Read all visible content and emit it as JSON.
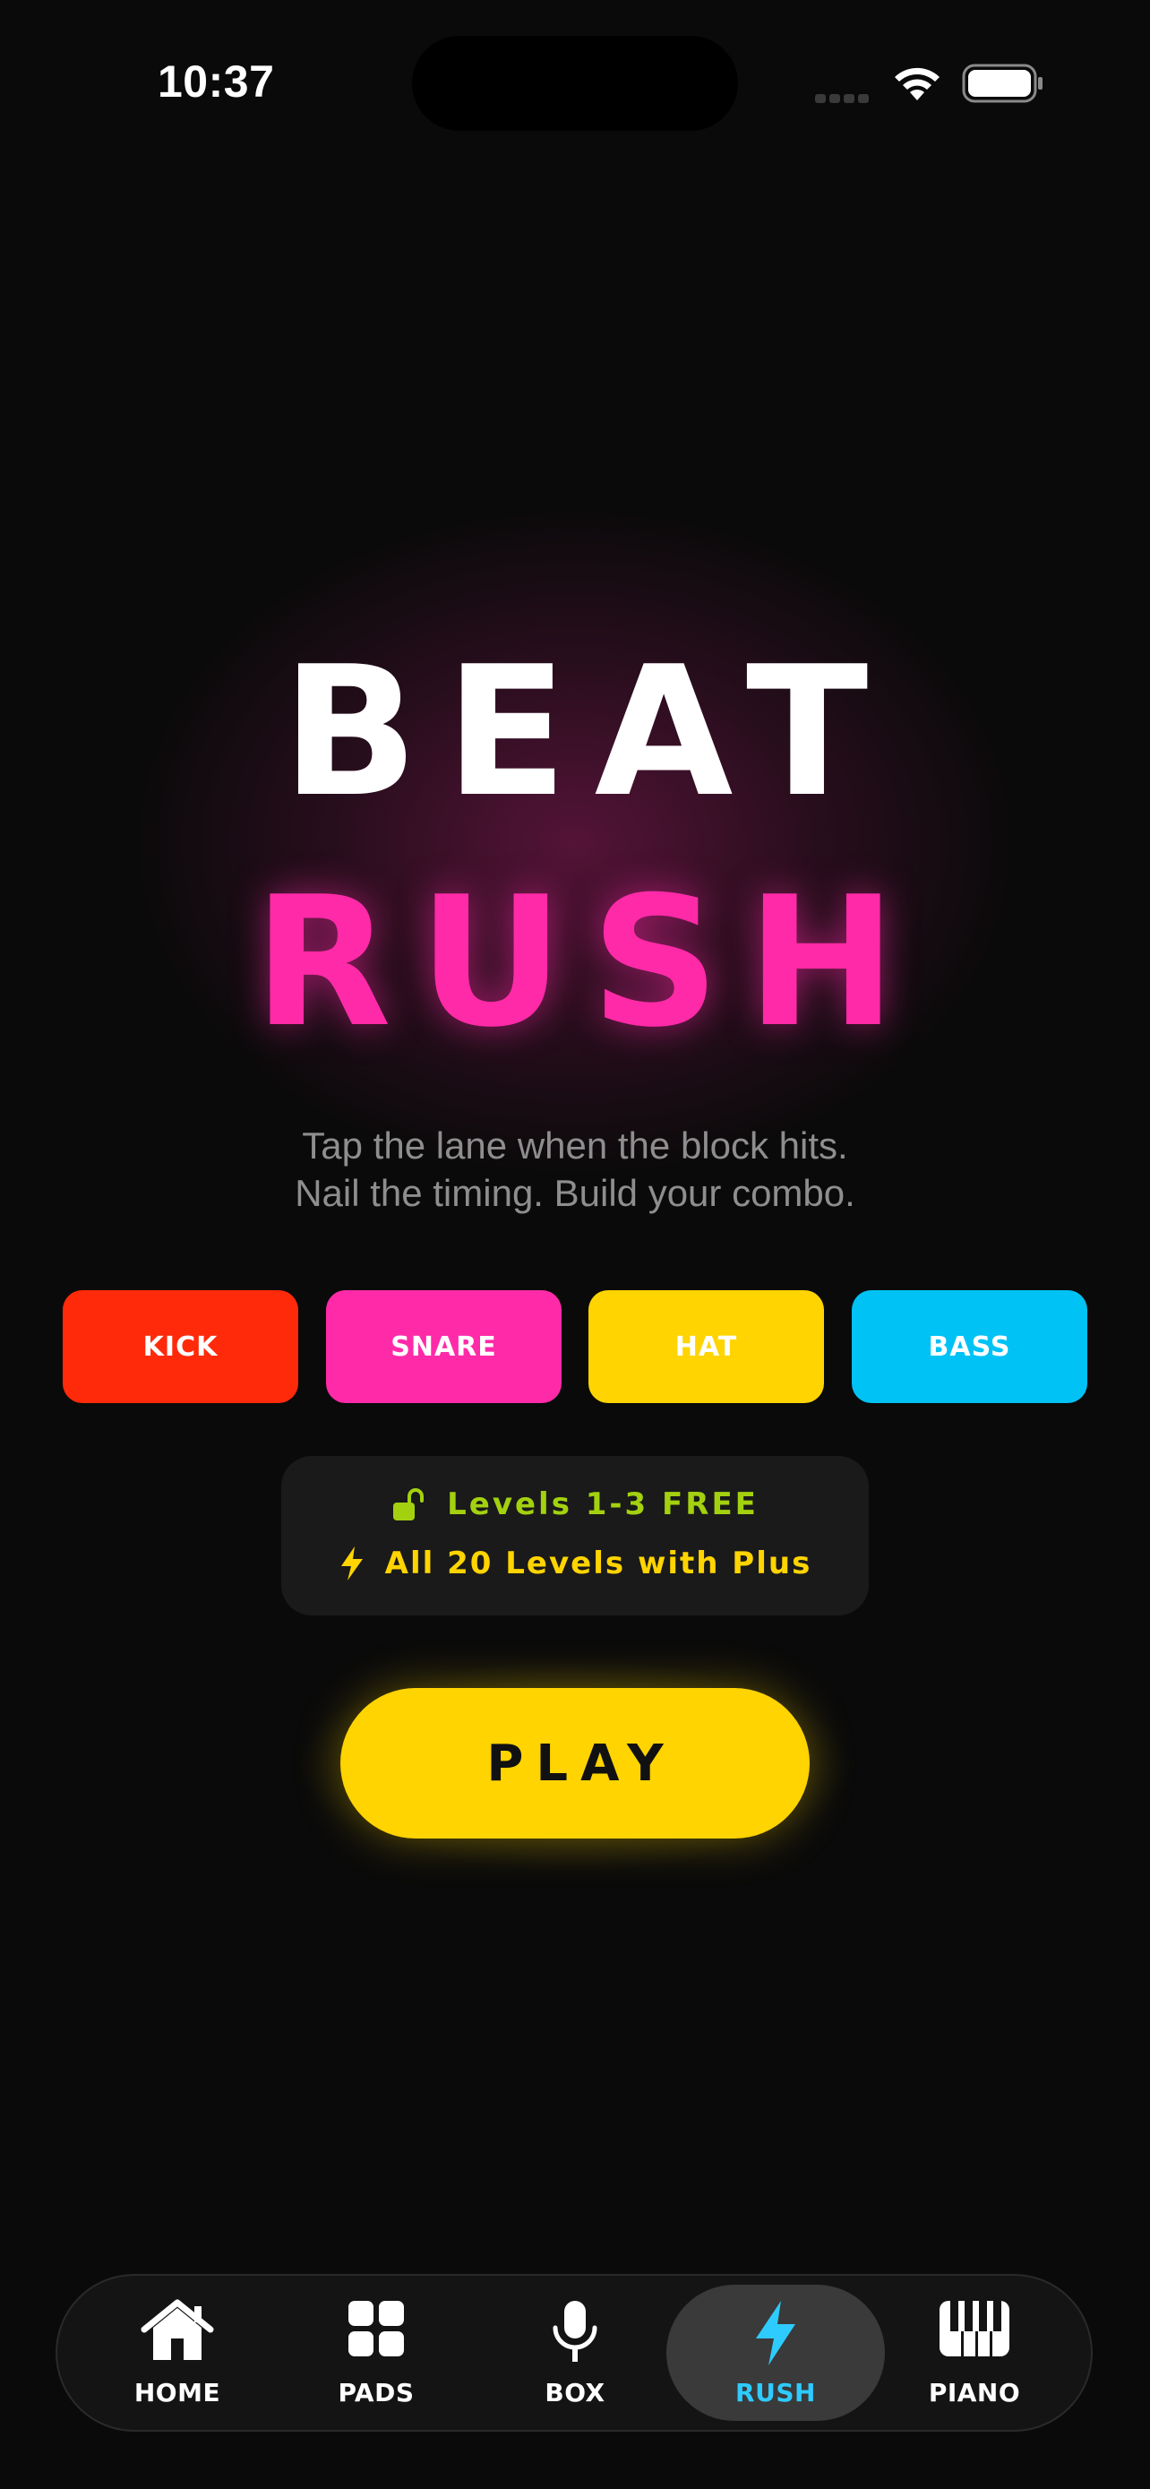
{
  "status_bar": {
    "time": "10:37"
  },
  "title": {
    "line1": "BEAT",
    "line2": "RUSH"
  },
  "subtitle": {
    "line1": "Tap the lane when the block hits.",
    "line2": "Nail the timing. Build your combo."
  },
  "lanes": [
    {
      "label": "KICK",
      "color": "#ff2a0a"
    },
    {
      "label": "SNARE",
      "color": "#ff2aa8"
    },
    {
      "label": "HAT",
      "color": "#ffd400"
    },
    {
      "label": "BASS",
      "color": "#00c2f5"
    }
  ],
  "levels": {
    "free_text": "Levels 1-3 FREE",
    "free_icon": "unlock-icon",
    "plus_text": "All 20 Levels with Plus",
    "plus_icon": "bolt-icon"
  },
  "play_label": "PLAY",
  "tabs": [
    {
      "label": "HOME",
      "icon": "house-icon"
    },
    {
      "label": "PADS",
      "icon": "grid-icon"
    },
    {
      "label": "BOX",
      "icon": "microphone-icon"
    },
    {
      "label": "RUSH",
      "icon": "bolt-icon",
      "active": true
    },
    {
      "label": "PIANO",
      "icon": "piano-icon"
    }
  ],
  "colors": {
    "background": "#0a0a0a",
    "accent_pink": "#ff2aa8",
    "accent_yellow": "#ffd400",
    "accent_green": "#a3d10f",
    "accent_cyan": "#2ecbff"
  }
}
